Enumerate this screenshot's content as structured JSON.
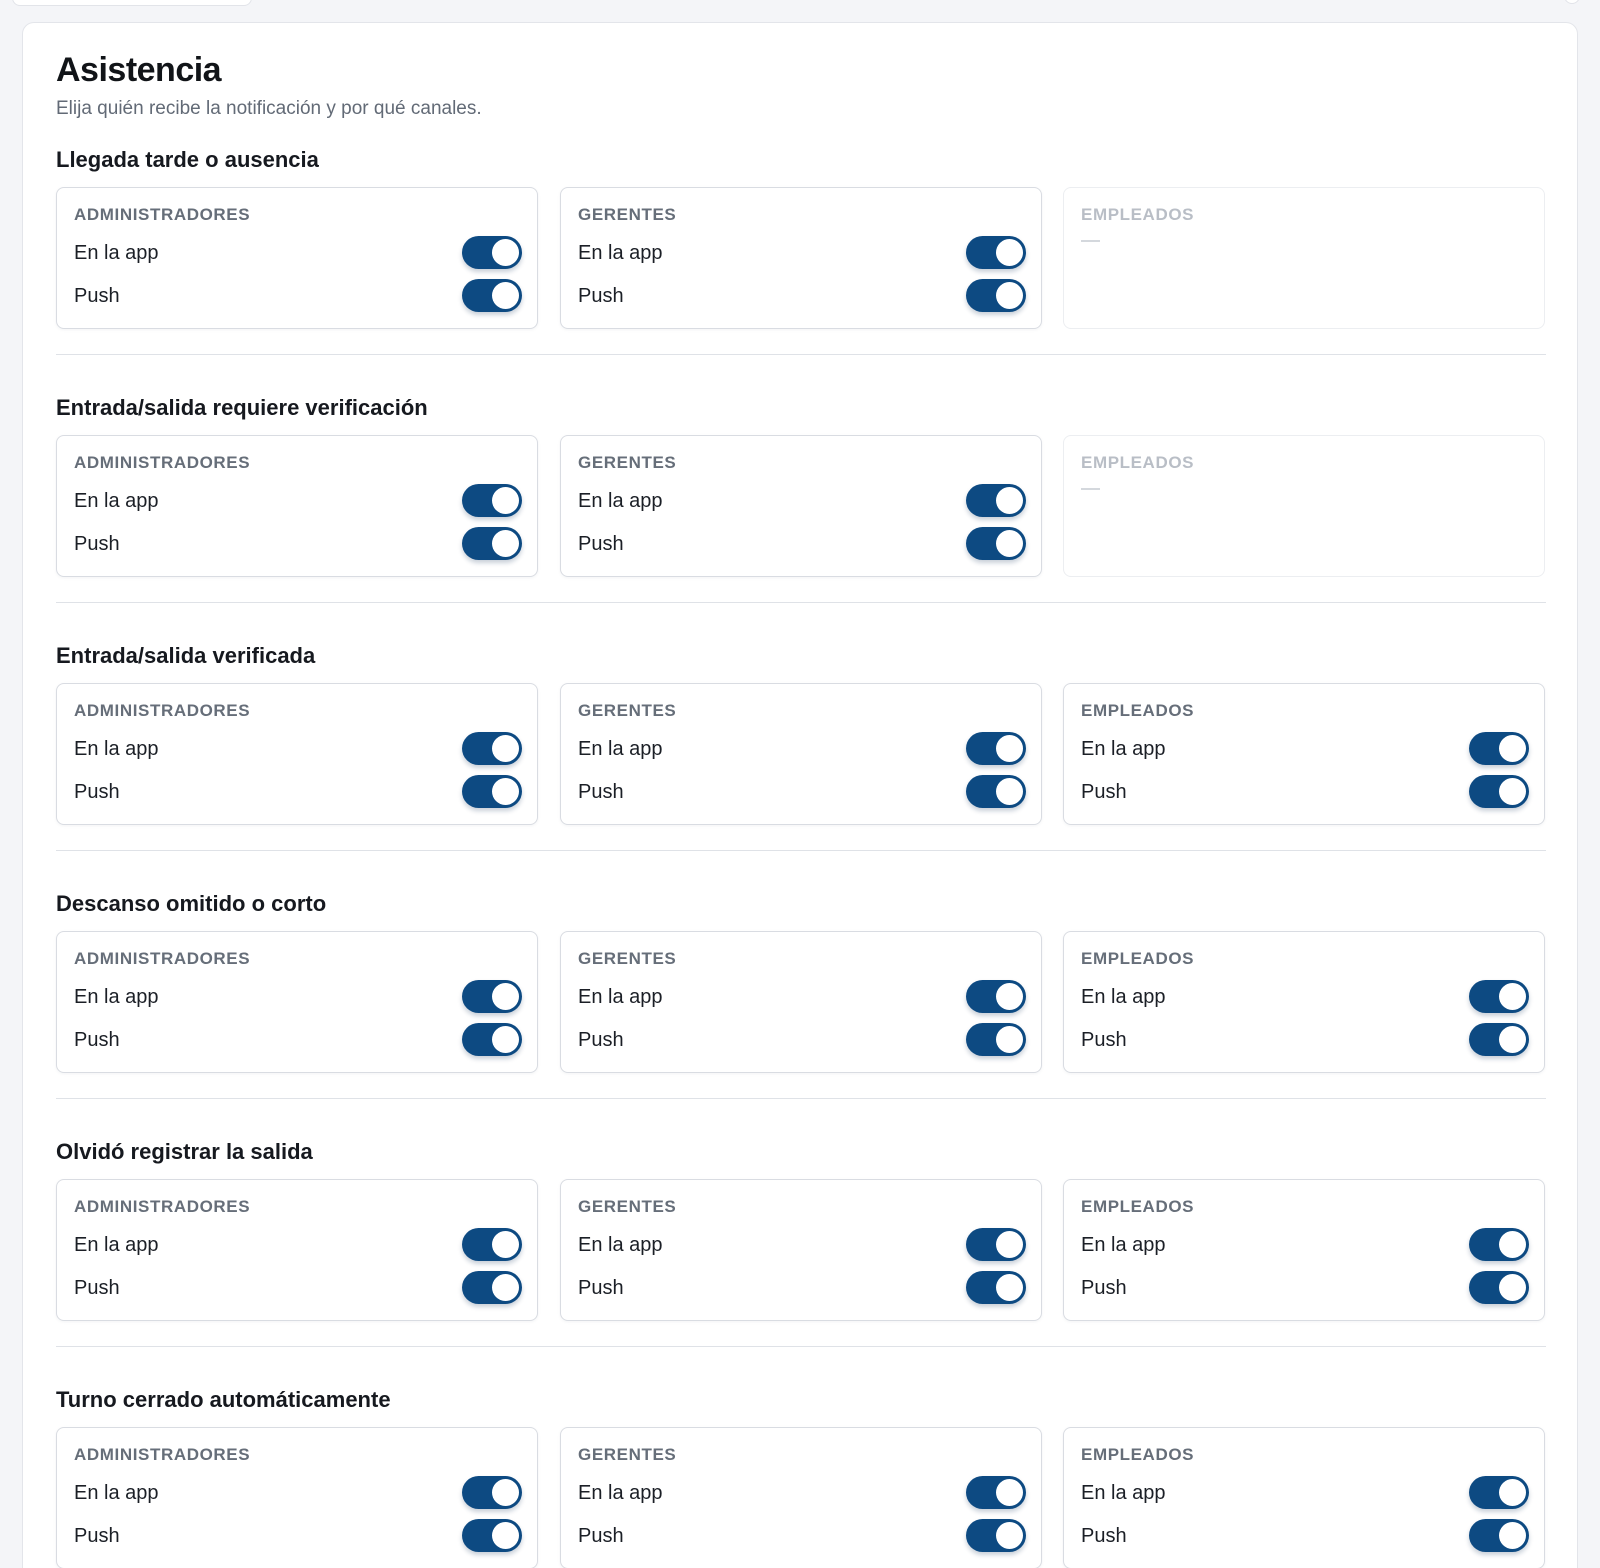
{
  "colors": {
    "accent": "#0d4a82",
    "page_bg": "#f4f5f8",
    "card_border": "#d9dce2",
    "muted_text": "#626a76"
  },
  "header": {
    "title": "Asistencia",
    "subtitle": "Elija quién recibe la notificación y por qué canales."
  },
  "sections": [
    {
      "title": "Llegada tarde o ausencia",
      "roles": [
        {
          "label": "ADMINISTRADORES",
          "enabled": true,
          "channels": [
            {
              "label": "En la app",
              "on": true
            },
            {
              "label": "Push",
              "on": true
            }
          ]
        },
        {
          "label": "GERENTES",
          "enabled": true,
          "channels": [
            {
              "label": "En la app",
              "on": true
            },
            {
              "label": "Push",
              "on": true
            }
          ]
        },
        {
          "label": "EMPLEADOS",
          "enabled": false,
          "placeholder": "—",
          "channels": []
        }
      ]
    },
    {
      "title": "Entrada/salida requiere verificación",
      "roles": [
        {
          "label": "ADMINISTRADORES",
          "enabled": true,
          "channels": [
            {
              "label": "En la app",
              "on": true
            },
            {
              "label": "Push",
              "on": true
            }
          ]
        },
        {
          "label": "GERENTES",
          "enabled": true,
          "channels": [
            {
              "label": "En la app",
              "on": true
            },
            {
              "label": "Push",
              "on": true
            }
          ]
        },
        {
          "label": "EMPLEADOS",
          "enabled": false,
          "placeholder": "—",
          "channels": []
        }
      ]
    },
    {
      "title": "Entrada/salida verificada",
      "roles": [
        {
          "label": "ADMINISTRADORES",
          "enabled": true,
          "channels": [
            {
              "label": "En la app",
              "on": true
            },
            {
              "label": "Push",
              "on": true
            }
          ]
        },
        {
          "label": "GERENTES",
          "enabled": true,
          "channels": [
            {
              "label": "En la app",
              "on": true
            },
            {
              "label": "Push",
              "on": true
            }
          ]
        },
        {
          "label": "EMPLEADOS",
          "enabled": true,
          "channels": [
            {
              "label": "En la app",
              "on": true
            },
            {
              "label": "Push",
              "on": true
            }
          ]
        }
      ]
    },
    {
      "title": "Descanso omitido o corto",
      "roles": [
        {
          "label": "ADMINISTRADORES",
          "enabled": true,
          "channels": [
            {
              "label": "En la app",
              "on": true
            },
            {
              "label": "Push",
              "on": true
            }
          ]
        },
        {
          "label": "GERENTES",
          "enabled": true,
          "channels": [
            {
              "label": "En la app",
              "on": true
            },
            {
              "label": "Push",
              "on": true
            }
          ]
        },
        {
          "label": "EMPLEADOS",
          "enabled": true,
          "channels": [
            {
              "label": "En la app",
              "on": true
            },
            {
              "label": "Push",
              "on": true
            }
          ]
        }
      ]
    },
    {
      "title": "Olvidó registrar la salida",
      "roles": [
        {
          "label": "ADMINISTRADORES",
          "enabled": true,
          "channels": [
            {
              "label": "En la app",
              "on": true
            },
            {
              "label": "Push",
              "on": true
            }
          ]
        },
        {
          "label": "GERENTES",
          "enabled": true,
          "channels": [
            {
              "label": "En la app",
              "on": true
            },
            {
              "label": "Push",
              "on": true
            }
          ]
        },
        {
          "label": "EMPLEADOS",
          "enabled": true,
          "channels": [
            {
              "label": "En la app",
              "on": true
            },
            {
              "label": "Push",
              "on": true
            }
          ]
        }
      ]
    },
    {
      "title": "Turno cerrado automáticamente",
      "roles": [
        {
          "label": "ADMINISTRADORES",
          "enabled": true,
          "channels": [
            {
              "label": "En la app",
              "on": true
            },
            {
              "label": "Push",
              "on": true
            }
          ]
        },
        {
          "label": "GERENTES",
          "enabled": true,
          "channels": [
            {
              "label": "En la app",
              "on": true
            },
            {
              "label": "Push",
              "on": true
            }
          ]
        },
        {
          "label": "EMPLEADOS",
          "enabled": true,
          "channels": [
            {
              "label": "En la app",
              "on": true
            },
            {
              "label": "Push",
              "on": true
            }
          ]
        }
      ]
    }
  ]
}
